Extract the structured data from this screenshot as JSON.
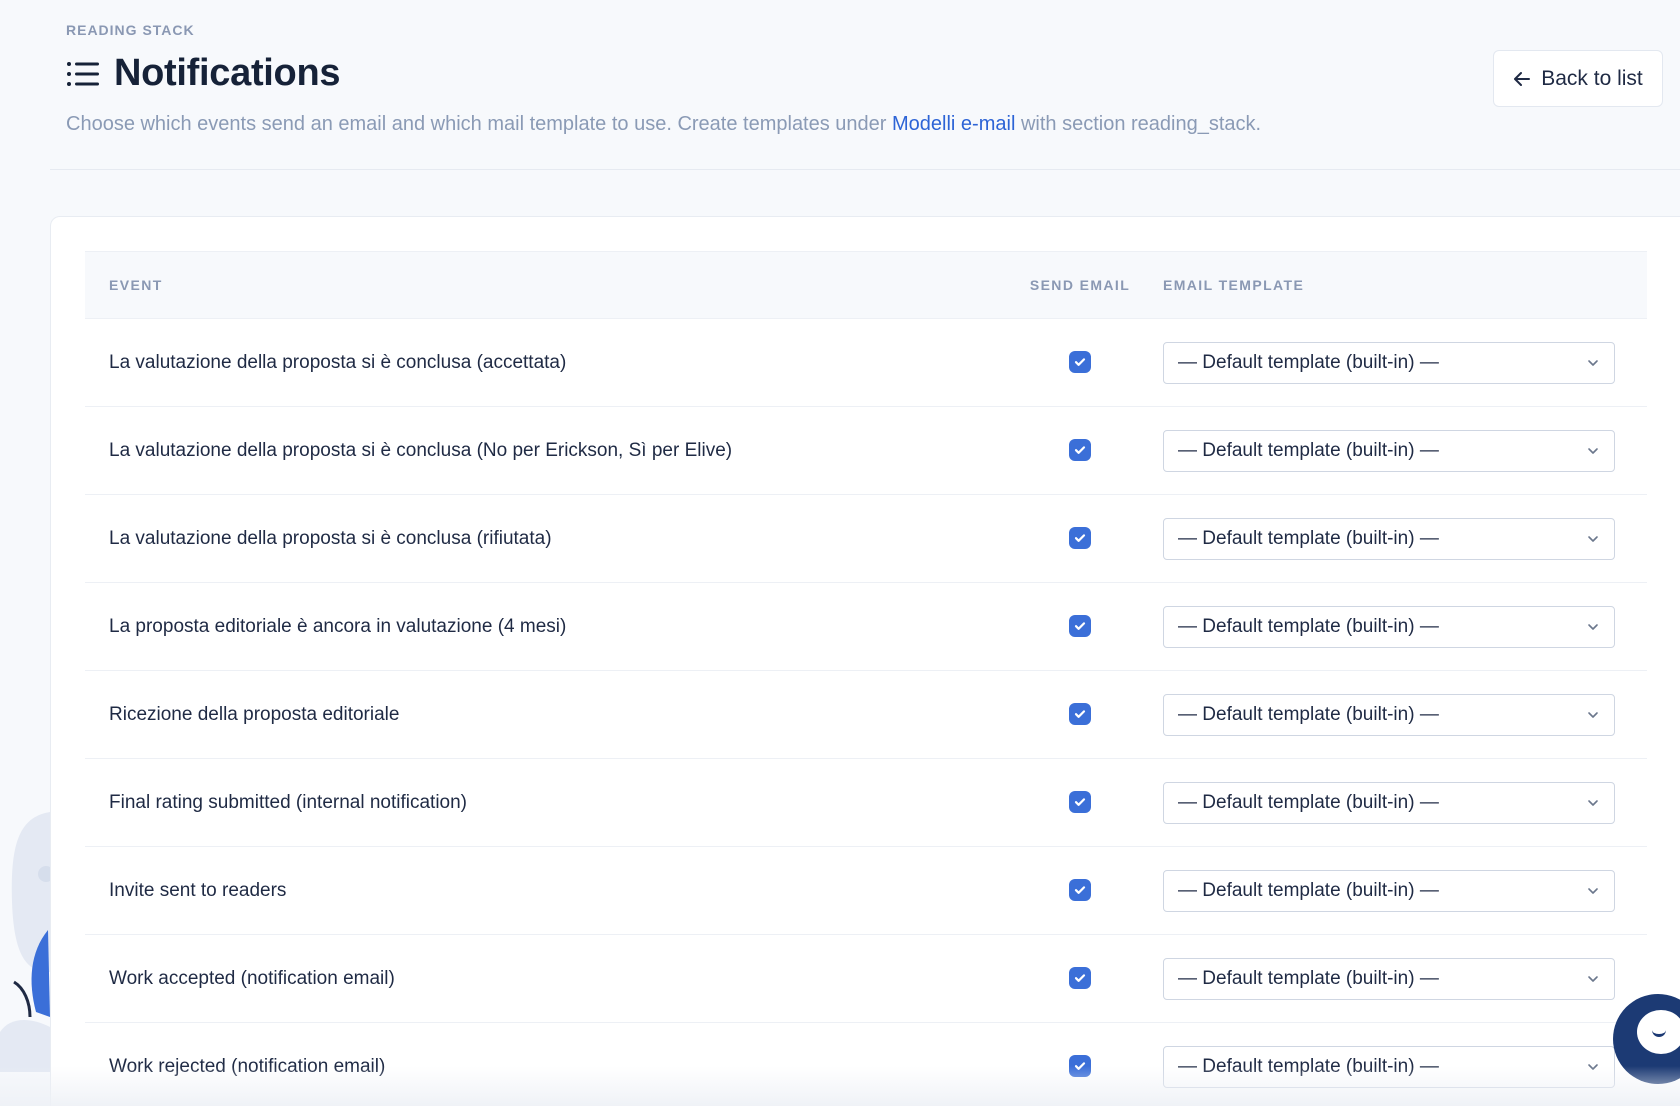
{
  "header": {
    "eyebrow": "READING STACK",
    "title": "Notifications",
    "subtitle_before": "Choose which events send an email and which mail template to use. Create templates under ",
    "subtitle_link": "Modelli e-mail",
    "subtitle_after": " with section reading_stack.",
    "back_label": "Back to list"
  },
  "table": {
    "columns": [
      "EVENT",
      "SEND EMAIL",
      "EMAIL TEMPLATE"
    ],
    "rows": [
      {
        "event": "La valutazione della proposta si è conclusa (accettata)",
        "send_email": true,
        "template": "— Default template (built-in) —"
      },
      {
        "event": "La valutazione della proposta si è conclusa (No per Erickson, Sì per Elive)",
        "send_email": true,
        "template": "— Default template (built-in) —"
      },
      {
        "event": "La valutazione della proposta si è conclusa (rifiutata)",
        "send_email": true,
        "template": "— Default template (built-in) —"
      },
      {
        "event": "La proposta editoriale è ancora in valutazione (4 mesi)",
        "send_email": true,
        "template": "— Default template (built-in) —"
      },
      {
        "event": "Ricezione della proposta editoriale",
        "send_email": true,
        "template": "— Default template (built-in) —"
      },
      {
        "event": "Final rating submitted (internal notification)",
        "send_email": true,
        "template": "— Default template (built-in) —"
      },
      {
        "event": "Invite sent to readers",
        "send_email": true,
        "template": "— Default template (built-in) —"
      },
      {
        "event": "Work accepted (notification email)",
        "send_email": true,
        "template": "— Default template (built-in) —"
      },
      {
        "event": "Work rejected (notification email)",
        "send_email": true,
        "template": "— Default template (built-in) —"
      }
    ]
  },
  "colors": {
    "accent": "#3b6fd8",
    "link": "#2d64d6",
    "chat": "#1c3a74"
  },
  "icons": {
    "title": "list-icon",
    "back": "arrow-left-icon",
    "check": "checkmark-icon",
    "select": "chevron-down-icon",
    "chat": "chat-icon"
  }
}
